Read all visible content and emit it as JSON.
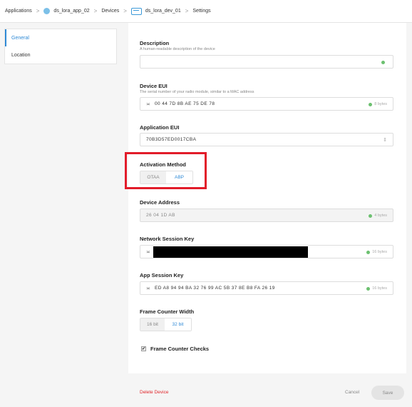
{
  "breadcrumb": {
    "applications": "Applications",
    "app_name": "ds_lora_app_02",
    "devices": "Devices",
    "device_name": "ds_lora_dev_01",
    "settings": "Settings",
    "separator": ">"
  },
  "sidebar": {
    "items": [
      {
        "label": "General"
      },
      {
        "label": "Location"
      }
    ]
  },
  "form": {
    "description": {
      "label": "Description",
      "hint": "A human-readable description of the device",
      "value": ""
    },
    "device_eui": {
      "label": "Device EUI",
      "hint": "The serial number of your radio module, similar to a MAC address",
      "value": "00 44 7D 8B AE 75 DE 78",
      "size": "8 bytes",
      "prefix": "≍"
    },
    "app_eui": {
      "label": "Application EUI",
      "value": "70B3D57ED0017CBA",
      "chevron": "⇕"
    },
    "activation": {
      "label": "Activation Method",
      "options": [
        "OTAA",
        "ABP"
      ],
      "selected": "ABP"
    },
    "device_address": {
      "label": "Device Address",
      "value": "26 04 1D AB",
      "size": "4 bytes"
    },
    "nwk_session_key": {
      "label": "Network Session Key",
      "value": "",
      "size": "16 bytes",
      "prefix": "≍"
    },
    "app_session_key": {
      "label": "App Session Key",
      "value": "ED A8 94 94 BA 32 76 99 AC 5B 37 8E B8 FA 26 19",
      "size": "16 bytes",
      "prefix": "≍"
    },
    "frame_counter_width": {
      "label": "Frame Counter Width",
      "options": [
        "16 bit",
        "32 bit"
      ],
      "selected": "32 bit"
    },
    "frame_counter_checks": {
      "label": "Frame Counter Checks",
      "checked": true,
      "mark": "✔"
    }
  },
  "footer": {
    "delete_label": "Delete Device",
    "cancel_label": "Cancel",
    "save_label": "Save"
  },
  "colors": {
    "accent": "#2f8ad6",
    "danger": "#e0262b",
    "highlight": "#e21c2a",
    "ok": "#6cc070"
  }
}
